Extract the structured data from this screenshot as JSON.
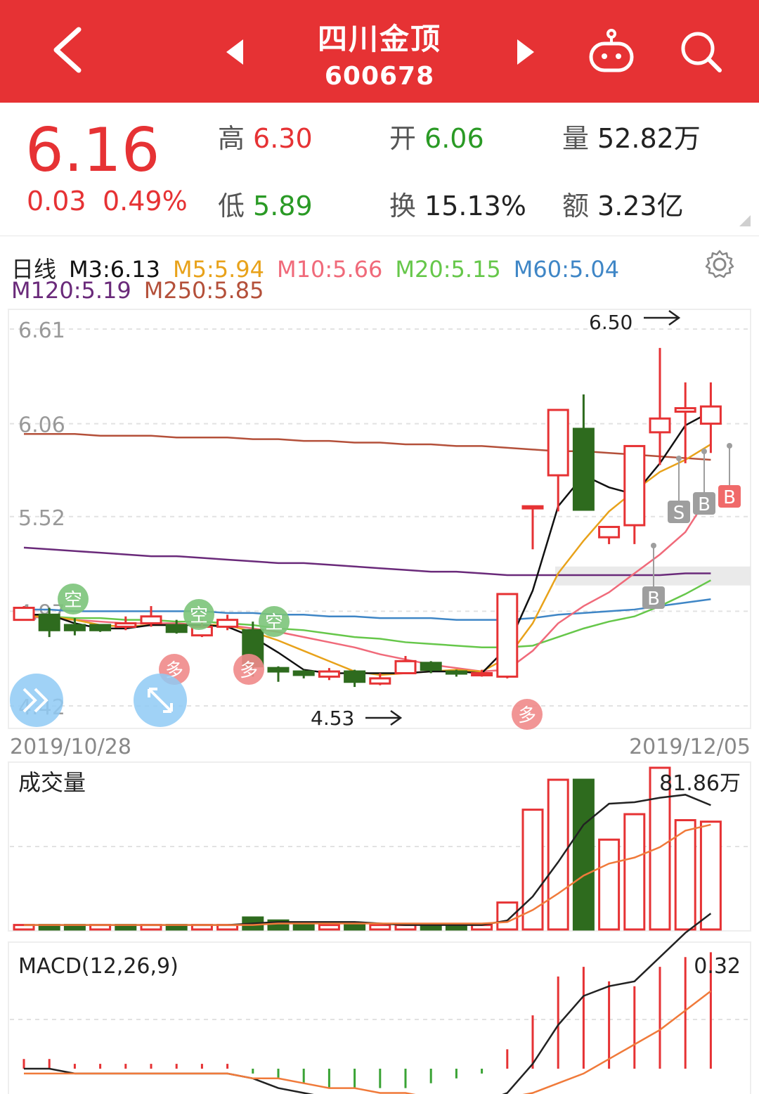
{
  "header": {
    "stock_name": "四川金顶",
    "stock_code": "600678",
    "icons": [
      "back-icon",
      "prev-stock-icon",
      "next-stock-icon",
      "robot-icon",
      "search-icon"
    ]
  },
  "quote": {
    "price": "6.16",
    "change": "0.03",
    "change_pct": "0.49%",
    "high_label": "高",
    "high": "6.30",
    "open_label": "开",
    "open": "6.06",
    "volume_label": "量",
    "volume": "52.82万",
    "low_label": "低",
    "low": "5.89",
    "turnover_label": "换",
    "turnover": "15.13%",
    "amount_label": "额",
    "amount": "3.23亿"
  },
  "ma": {
    "period": "日线",
    "m3": "M3:6.13",
    "m5": "M5:5.94",
    "m10": "M10:5.66",
    "m20": "M20:5.15",
    "m60": "M60:5.04",
    "m120": "M120:5.19",
    "m250": "M250:5.85"
  },
  "colors": {
    "up": "#e63234",
    "down": "#2e6b1e",
    "m3": "#111111",
    "m5": "#e8a21a",
    "m10": "#f06a7a",
    "m20": "#66c74a",
    "m60": "#3f86c6",
    "m120": "#6a2a7a",
    "m250": "#b4503a"
  },
  "chart_data": [
    {
      "type": "candlestick",
      "x_start_label": "2019/10/28",
      "x_end_label": "2019/12/05",
      "y_tick_labels": [
        "6.61",
        "6.06",
        "5.52",
        "4.97",
        "4.42"
      ],
      "ylim": [
        4.42,
        6.61
      ],
      "max_annotation": "6.50",
      "min_annotation": "4.53",
      "candles": [
        {
          "o": 4.92,
          "c": 4.99,
          "h": 5.0,
          "l": 4.92
        },
        {
          "o": 4.95,
          "c": 4.86,
          "h": 4.99,
          "l": 4.82
        },
        {
          "o": 4.89,
          "c": 4.86,
          "h": 4.93,
          "l": 4.83
        },
        {
          "o": 4.89,
          "c": 4.86,
          "h": 4.89,
          "l": 4.85
        },
        {
          "o": 4.88,
          "c": 4.9,
          "h": 4.94,
          "l": 4.86
        },
        {
          "o": 4.9,
          "c": 4.94,
          "h": 5.0,
          "l": 4.88
        },
        {
          "o": 4.89,
          "c": 4.85,
          "h": 4.92,
          "l": 4.84
        },
        {
          "o": 4.83,
          "c": 4.88,
          "h": 4.92,
          "l": 4.82
        },
        {
          "o": 4.88,
          "c": 4.92,
          "h": 4.95,
          "l": 4.86
        },
        {
          "o": 4.86,
          "c": 4.65,
          "h": 4.91,
          "l": 4.59
        },
        {
          "o": 4.64,
          "c": 4.62,
          "h": 4.65,
          "l": 4.56
        },
        {
          "o": 4.62,
          "c": 4.6,
          "h": 4.63,
          "l": 4.58
        },
        {
          "o": 4.59,
          "c": 4.62,
          "h": 4.64,
          "l": 4.57
        },
        {
          "o": 4.62,
          "c": 4.56,
          "h": 4.63,
          "l": 4.53
        },
        {
          "o": 4.55,
          "c": 4.58,
          "h": 4.61,
          "l": 4.54
        },
        {
          "o": 4.61,
          "c": 4.68,
          "h": 4.71,
          "l": 4.61
        },
        {
          "o": 4.67,
          "c": 4.63,
          "h": 4.68,
          "l": 4.61
        },
        {
          "o": 4.62,
          "c": 4.61,
          "h": 4.63,
          "l": 4.59
        },
        {
          "o": 4.6,
          "c": 4.61,
          "h": 4.63,
          "l": 4.59
        },
        {
          "o": 4.59,
          "c": 5.07,
          "h": 5.07,
          "l": 4.58
        },
        {
          "o": 5.58,
          "c": 5.58,
          "h": 5.58,
          "l": 5.33
        },
        {
          "o": 5.76,
          "c": 6.14,
          "h": 6.14,
          "l": 5.55
        },
        {
          "o": 6.03,
          "c": 5.56,
          "h": 6.23,
          "l": 5.56
        },
        {
          "o": 5.4,
          "c": 5.46,
          "h": 5.46,
          "l": 5.36
        },
        {
          "o": 5.47,
          "c": 5.93,
          "h": 5.93,
          "l": 5.36
        },
        {
          "o": 6.01,
          "c": 6.09,
          "h": 6.5,
          "l": 5.82
        },
        {
          "o": 6.13,
          "c": 6.15,
          "h": 6.3,
          "l": 5.83
        },
        {
          "o": 6.06,
          "c": 6.16,
          "h": 6.3,
          "l": 5.89
        }
      ],
      "series": [
        {
          "name": "M3",
          "values": [
            4.95,
            4.95,
            4.9,
            4.87,
            4.87,
            4.89,
            4.89,
            4.89,
            4.88,
            4.82,
            4.73,
            4.63,
            4.61,
            4.61,
            4.61,
            4.61,
            4.62,
            4.62,
            4.61,
            4.76,
            5.09,
            5.58,
            5.76,
            5.69,
            5.65,
            5.83,
            6.05,
            6.13
          ]
        },
        {
          "name": "M5",
          "values": [
            4.94,
            4.94,
            4.92,
            4.89,
            4.88,
            4.89,
            4.89,
            4.89,
            4.89,
            4.85,
            4.8,
            4.74,
            4.68,
            4.62,
            4.6,
            4.61,
            4.62,
            4.63,
            4.62,
            4.7,
            4.9,
            5.19,
            5.38,
            5.55,
            5.67,
            5.78,
            5.85,
            5.94
          ]
        },
        {
          "name": "M10",
          "values": [
            4.94,
            4.93,
            4.92,
            4.91,
            4.9,
            4.9,
            4.9,
            4.89,
            4.89,
            4.87,
            4.85,
            4.82,
            4.79,
            4.76,
            4.72,
            4.69,
            4.66,
            4.64,
            4.62,
            4.63,
            4.74,
            4.9,
            5.0,
            5.08,
            5.19,
            5.3,
            5.43,
            5.66
          ]
        },
        {
          "name": "M20",
          "values": [
            4.95,
            4.94,
            4.93,
            4.93,
            4.92,
            4.92,
            4.91,
            4.91,
            4.9,
            4.89,
            4.87,
            4.86,
            4.84,
            4.82,
            4.81,
            4.79,
            4.78,
            4.77,
            4.76,
            4.76,
            4.77,
            4.82,
            4.87,
            4.91,
            4.94,
            5.0,
            5.07,
            5.15
          ]
        },
        {
          "name": "M60",
          "values": [
            4.98,
            4.98,
            4.97,
            4.97,
            4.97,
            4.97,
            4.97,
            4.97,
            4.96,
            4.96,
            4.95,
            4.95,
            4.94,
            4.94,
            4.93,
            4.93,
            4.93,
            4.92,
            4.92,
            4.92,
            4.93,
            4.95,
            4.96,
            4.97,
            4.98,
            5.0,
            5.02,
            5.04
          ]
        },
        {
          "name": "M120",
          "values": [
            5.34,
            5.33,
            5.32,
            5.31,
            5.3,
            5.29,
            5.29,
            5.28,
            5.27,
            5.26,
            5.25,
            5.25,
            5.24,
            5.23,
            5.22,
            5.21,
            5.2,
            5.2,
            5.19,
            5.18,
            5.18,
            5.18,
            5.18,
            5.18,
            5.18,
            5.18,
            5.19,
            5.19
          ]
        },
        {
          "name": "M250",
          "values": [
            6.0,
            6.0,
            6.0,
            5.99,
            5.99,
            5.99,
            5.98,
            5.98,
            5.98,
            5.97,
            5.97,
            5.96,
            5.96,
            5.95,
            5.95,
            5.94,
            5.94,
            5.93,
            5.93,
            5.92,
            5.91,
            5.9,
            5.9,
            5.89,
            5.88,
            5.87,
            5.86,
            5.85
          ]
        }
      ],
      "signals": [
        {
          "label": "空",
          "index": 2,
          "type": "sell"
        },
        {
          "label": "空",
          "index": 7,
          "type": "sell"
        },
        {
          "label": "空",
          "index": 10,
          "type": "sell"
        },
        {
          "label": "多",
          "index": 6,
          "type": "buy"
        },
        {
          "label": "多",
          "index": 9,
          "type": "buy"
        },
        {
          "label": "多",
          "index": 20,
          "type": "buy"
        },
        {
          "label": "S",
          "index": 26,
          "type": "trade"
        },
        {
          "label": "B",
          "index": 27,
          "type": "trade"
        },
        {
          "label": "B",
          "index": 28,
          "type": "trade-active"
        },
        {
          "label": "B",
          "index": 25,
          "type": "trade"
        }
      ]
    },
    {
      "type": "bar",
      "title": "成交量",
      "max_label": "81.86万",
      "values": [
        3,
        3,
        3,
        3,
        3,
        3,
        3,
        3,
        3,
        8,
        6,
        4,
        3,
        3,
        3,
        3,
        3,
        3,
        3,
        18,
        80,
        100,
        100,
        60,
        77,
        108,
        73,
        72
      ],
      "up": [
        true,
        false,
        false,
        true,
        false,
        true,
        false,
        true,
        true,
        false,
        false,
        false,
        true,
        false,
        true,
        true,
        false,
        false,
        true,
        true,
        true,
        true,
        false,
        true,
        true,
        true,
        true,
        true
      ],
      "series": [
        {
          "name": "MA5",
          "values": [
            3,
            3,
            3,
            3,
            3,
            3,
            3,
            3,
            3,
            4,
            5,
            5,
            5,
            5,
            4,
            3,
            3,
            3,
            3,
            6,
            22,
            45,
            70,
            84,
            85,
            88,
            90,
            83
          ]
        },
        {
          "name": "MA10",
          "values": [
            3,
            3,
            3,
            3,
            3,
            3,
            3,
            3,
            3,
            3,
            4,
            4,
            4,
            4,
            4,
            4,
            4,
            4,
            4,
            5,
            13,
            24,
            36,
            44,
            48,
            55,
            66,
            70
          ]
        }
      ]
    },
    {
      "type": "bar",
      "title": "MACD(12,26,9)",
      "max_label": "0.32",
      "macd_hist": [
        0.02,
        0.02,
        0.01,
        0.01,
        0.01,
        0.01,
        0.01,
        0.01,
        0.01,
        -0.01,
        -0.02,
        -0.03,
        -0.04,
        -0.04,
        -0.04,
        -0.04,
        -0.03,
        -0.02,
        -0.01,
        0.04,
        0.11,
        0.19,
        0.21,
        0.18,
        0.17,
        0.21,
        0.23,
        0.24
      ],
      "series": [
        {
          "name": "DIF",
          "values": [
            0.0,
            0.0,
            -0.01,
            -0.01,
            -0.01,
            -0.01,
            -0.01,
            -0.01,
            -0.01,
            -0.02,
            -0.04,
            -0.05,
            -0.06,
            -0.06,
            -0.07,
            -0.07,
            -0.07,
            -0.07,
            -0.07,
            -0.05,
            0.01,
            0.09,
            0.15,
            0.17,
            0.18,
            0.23,
            0.28,
            0.32
          ]
        },
        {
          "name": "DEA",
          "values": [
            -0.01,
            -0.01,
            -0.01,
            -0.01,
            -0.01,
            -0.01,
            -0.01,
            -0.01,
            -0.01,
            -0.02,
            -0.02,
            -0.03,
            -0.04,
            -0.04,
            -0.05,
            -0.05,
            -0.06,
            -0.06,
            -0.06,
            -0.06,
            -0.05,
            -0.03,
            -0.01,
            0.02,
            0.05,
            0.08,
            0.12,
            0.16
          ]
        }
      ]
    }
  ]
}
